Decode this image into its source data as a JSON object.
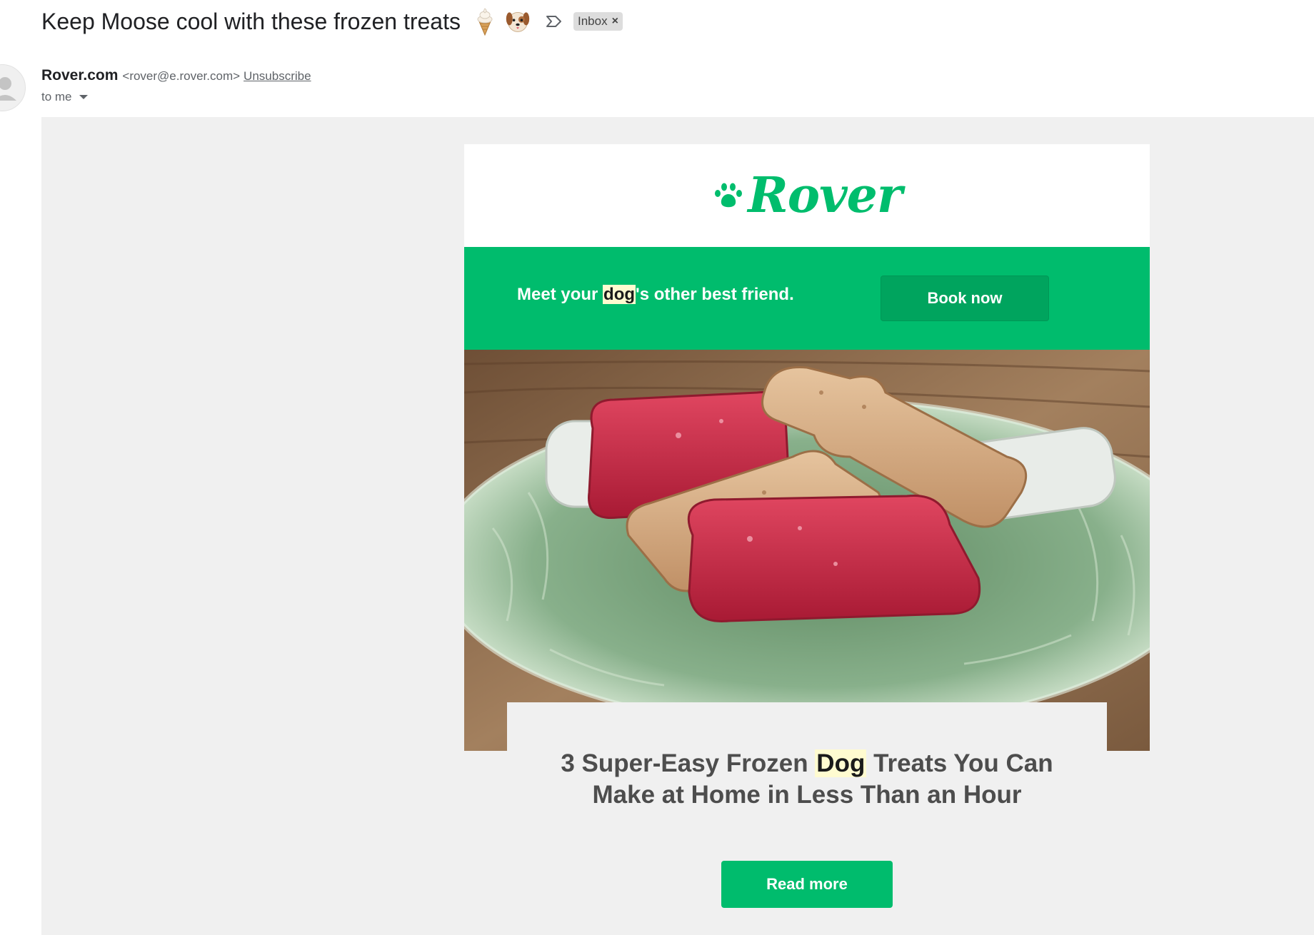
{
  "email": {
    "subject": "Keep Moose cool with these frozen treats",
    "subject_emojis": [
      "ice-cream-icon",
      "dog-face-icon"
    ],
    "label_chip": "Inbox",
    "label_chip_remove": "×",
    "sender_name": "Rover.com",
    "sender_email": "<rover@e.rover.com>",
    "unsubscribe_label": "Unsubscribe",
    "recipient_label": "to me"
  },
  "body": {
    "logo_text": "Rover",
    "banner": {
      "text_before": "Meet your ",
      "highlight": "dog",
      "text_after": "'s other best friend.",
      "button_label": "Book now"
    },
    "article": {
      "title_before": "3 Super-Easy Frozen ",
      "title_highlight": "Dog",
      "title_after": " Treats You Can Make at Home in Less Than an Hour",
      "button_label": "Read more"
    }
  },
  "colors": {
    "brand_green": "#00bc6d",
    "highlight": "#fffbd0",
    "email_background": "#f0f0f0"
  }
}
